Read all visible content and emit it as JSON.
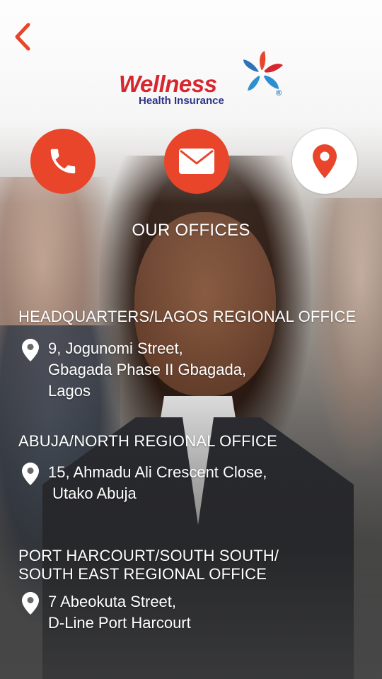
{
  "brand": {
    "name": "Wellness",
    "tagline": "Health Insurance",
    "registered_mark": "®",
    "primary_color": "#d8262f",
    "secondary_color": "#2e3185",
    "accent_color": "#e8452a"
  },
  "nav": {
    "back_icon": "chevron-left-icon"
  },
  "contact_buttons": [
    {
      "icon": "phone-icon",
      "active": false
    },
    {
      "icon": "mail-icon",
      "active": false
    },
    {
      "icon": "map-pin-icon",
      "active": true
    }
  ],
  "section_title": "OUR OFFICES",
  "offices": [
    {
      "heading": [
        "HEADQUARTERS/LAGOS REGIONAL OFFICE"
      ],
      "address": [
        "9, Jogunomi Street,",
        "Gbagada Phase II Gbagada,",
        "Lagos"
      ]
    },
    {
      "heading": [
        "ABUJA/NORTH REGIONAL OFFICE"
      ],
      "address": [
        "15, Ahmadu Ali Crescent Close,",
        " Utako Abuja"
      ]
    },
    {
      "heading": [
        "PORT HARCOURT/SOUTH SOUTH/",
        "SOUTH EAST REGIONAL OFFICE"
      ],
      "address": [
        "7 Abeokuta Street,",
        "D-Line Port Harcourt"
      ]
    }
  ]
}
